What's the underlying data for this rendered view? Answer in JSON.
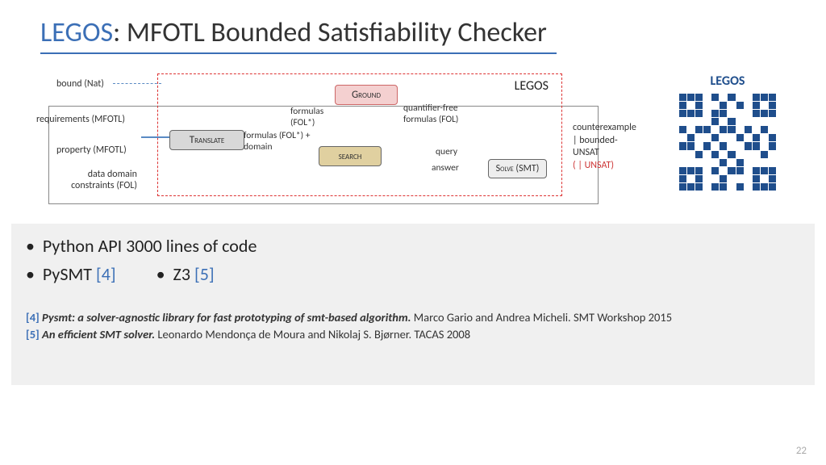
{
  "title": {
    "accent": "LEGOS",
    "rest": ": MFOTL Bounded Satisfiability Checker"
  },
  "diagram": {
    "box_label": "LEGOS",
    "inputs": [
      "bound (Nat)",
      "requirements (MFOTL)",
      "property (MFOTL)",
      "data domain constraints (FOL)"
    ],
    "stages": {
      "ground": "Ground",
      "translate": "Translate",
      "search": "search",
      "solve": "Solve (SMT)"
    },
    "flows": {
      "fol_dom": "formulas (FOL*) + domain",
      "fol_star": "formulas (FOL*)",
      "qf_fol": "quantifier-free formulas (FOL)",
      "query": "query",
      "answer": "answer"
    },
    "output": {
      "l1": "counterexample",
      "l2": "| bounded-",
      "l3": "UNSAT",
      "l4a": "(",
      "l4b": " | UNSAT)"
    }
  },
  "qr_title": "LEGOS",
  "bullets": {
    "line1": "Python API  3000 lines of code",
    "pysmt": "PySMT",
    "pysmt_ref": "[4]",
    "z3": "Z3",
    "z3_ref": "[5]"
  },
  "citations": {
    "c4": {
      "num": "[4]",
      "title": "Pysmt: a solver-agnostic library for fast prototyping of smt-based algorithm.",
      "rest": "  Marco Gario and Andrea  Micheli. SMT Workshop 2015"
    },
    "c5": {
      "num": "[5]",
      "title": "An efficient SMT solver.",
      "rest": " Leonardo Mendonça de Moura and Nikolaj S. Bjørner. TACAS 2008"
    }
  },
  "page": "22"
}
